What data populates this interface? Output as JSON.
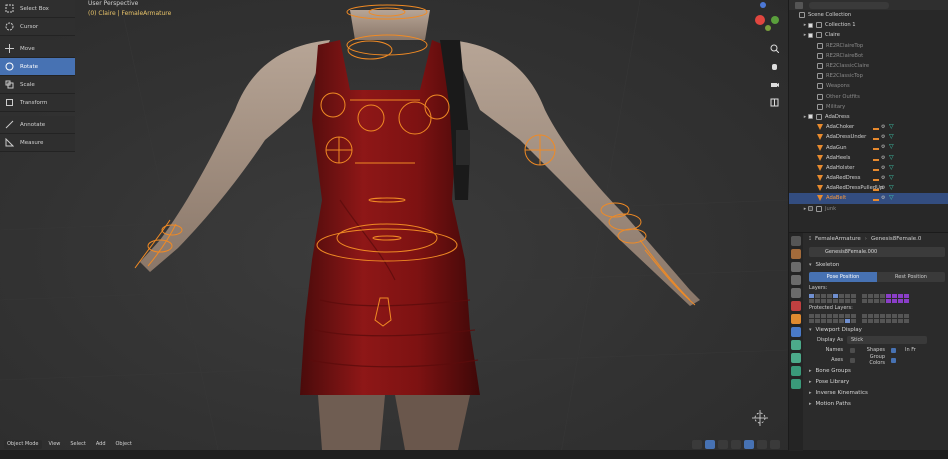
{
  "viewport": {
    "perspective_label": "User Perspective",
    "context_label": "(0) Claire | FemaleArmature"
  },
  "toolshelf": [
    {
      "label": "Select Box",
      "icon": "select-box-icon",
      "active": false
    },
    {
      "label": "Cursor",
      "icon": "cursor-icon",
      "active": false
    },
    {
      "label": "Move",
      "icon": "move-icon",
      "active": false
    },
    {
      "label": "Rotate",
      "icon": "rotate-icon",
      "active": true
    },
    {
      "label": "Scale",
      "icon": "scale-icon",
      "active": false
    },
    {
      "label": "Transform",
      "icon": "transform-icon",
      "active": false
    },
    {
      "label": "Annotate",
      "icon": "annotate-icon",
      "active": false
    },
    {
      "label": "Measure",
      "icon": "measure-icon",
      "active": false
    }
  ],
  "header": {
    "mode": "Object Mode",
    "menus": [
      "View",
      "Select",
      "Add",
      "Object"
    ]
  },
  "outliner": {
    "rows": [
      {
        "label": "Scene Collection",
        "indent": 0,
        "state": "normal"
      },
      {
        "label": "Collection 1",
        "indent": 1,
        "state": "normal"
      },
      {
        "label": "Claire",
        "indent": 1,
        "state": "normal"
      },
      {
        "label": "RE2RClaireTop",
        "indent": 2,
        "state": "dim"
      },
      {
        "label": "RE2RClaireBot",
        "indent": 2,
        "state": "dim"
      },
      {
        "label": "RE2ClassicClaire",
        "indent": 2,
        "state": "dim"
      },
      {
        "label": "RE2ClassicTop",
        "indent": 2,
        "state": "dim"
      },
      {
        "label": "Weapons",
        "indent": 2,
        "state": "dim"
      },
      {
        "label": "Other Outfits",
        "indent": 2,
        "state": "dim"
      },
      {
        "label": "Military",
        "indent": 2,
        "state": "dim"
      },
      {
        "label": "AdaDress",
        "indent": 1,
        "state": "normal"
      },
      {
        "label": "AdaChoker",
        "indent": 2,
        "state": "normal"
      },
      {
        "label": "AdaDressUnder",
        "indent": 2,
        "state": "normal"
      },
      {
        "label": "AdaGun",
        "indent": 2,
        "state": "normal"
      },
      {
        "label": "AdaHeels",
        "indent": 2,
        "state": "normal"
      },
      {
        "label": "AdaHolster",
        "indent": 2,
        "state": "normal"
      },
      {
        "label": "AdaRedDress",
        "indent": 2,
        "state": "normal"
      },
      {
        "label": "AdaRedDressPulledUp",
        "indent": 2,
        "state": "normal"
      },
      {
        "label": "AdaBelt",
        "indent": 2,
        "state": "selected"
      },
      {
        "label": "Junk",
        "indent": 1,
        "state": "dim"
      }
    ]
  },
  "properties": {
    "breadcrumb_object": "FemaleArmature",
    "breadcrumb_data": "Genesis8Female.0",
    "data_field": "Genesis8Female.000",
    "skeleton_panel": "Skeleton",
    "pose_position": "Pose Position",
    "rest_position": "Rest Position",
    "layers_label": "Layers:",
    "protected_label": "Protected Layers:",
    "viewport_display_panel": "Viewport Display",
    "display_as_label": "Display As",
    "display_as_value": "Stick",
    "names_label": "Names",
    "shapes_label": "Shapes",
    "in_front_label": "In Fr",
    "axes_label": "Axes",
    "group_colors_label": "Group Colors",
    "bone_groups": "Bone Groups",
    "pose_library": "Pose Library",
    "inverse_kinematics": "Inverse Kinematics",
    "motion_paths": "Motion Paths"
  },
  "colors": {
    "accent": "#4772b3",
    "bone_orange": "#f08a24",
    "dress_red": "#8a1414",
    "selected_text": "#ff9b3a"
  }
}
